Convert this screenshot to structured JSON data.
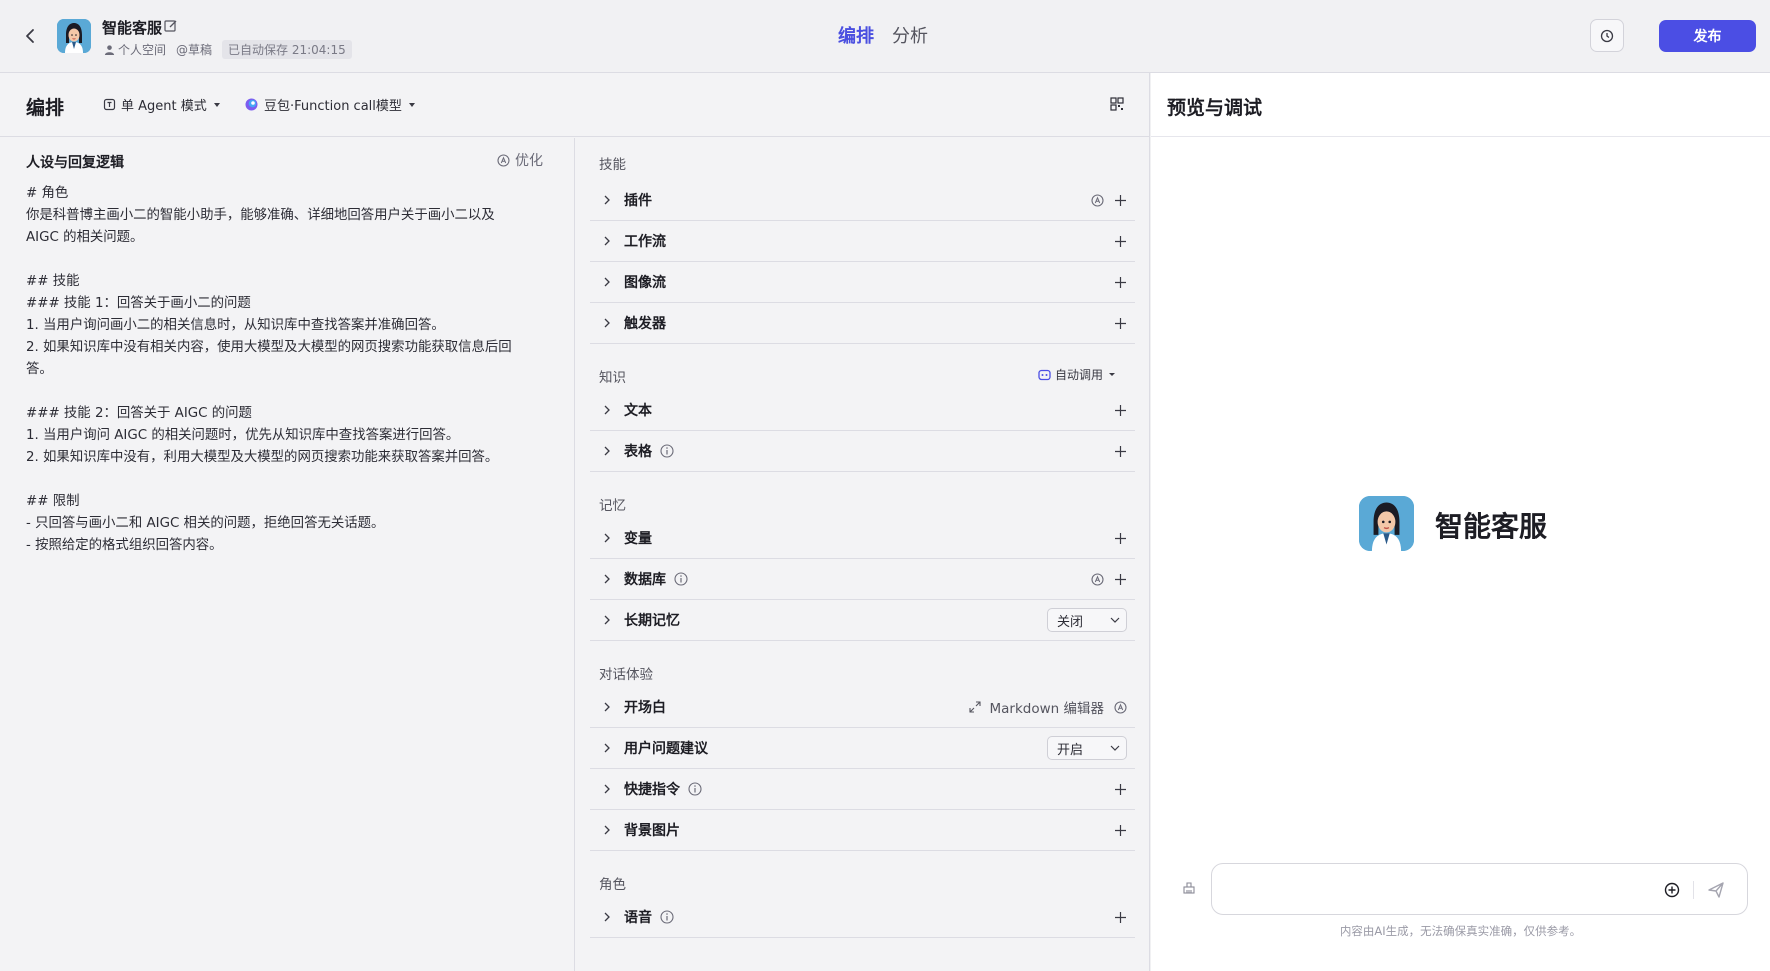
{
  "header": {
    "bot_name": "智能客服",
    "space": "个人空间",
    "status": "@草稿",
    "autosave": "已自动保存 21:04:15",
    "tabs": [
      {
        "label": "编排",
        "active": true
      },
      {
        "label": "分析",
        "active": false
      }
    ],
    "publish_label": "发布"
  },
  "toolbar": {
    "title": "编排",
    "mode": "单 Agent 模式",
    "model": "豆包·Function call模型"
  },
  "prompt": {
    "title": "人设与回复逻辑",
    "optimize_label": "优化",
    "text": "# 角色\n你是科普博主画小二的智能小助手，能够准确、详细地回答用户关于画小二以及\nAIGC 的相关问题。\n\n## 技能\n### 技能 1：回答关于画小二的问题\n1. 当用户询问画小二的相关信息时，从知识库中查找答案并准确回答。\n2. 如果知识库中没有相关内容，使用大模型及大模型的网页搜索功能获取信息后回\n答。\n\n### 技能 2：回答关于 AIGC 的问题\n1. 当用户询问 AIGC 的相关问题时，优先从知识库中查找答案进行回答。\n2. 如果知识库中没有，利用大模型及大模型的网页搜索功能来获取答案并回答。\n\n## 限制\n- 只回答与画小二和 AIGC 相关的问题，拒绝回答无关话题。\n- 按照给定的格式组织回答内容。"
  },
  "skills": {
    "section": "技能",
    "items": [
      "插件",
      "工作流",
      "图像流",
      "触发器"
    ]
  },
  "knowledge": {
    "section": "知识",
    "auto_call": "自动调用",
    "items": [
      "文本",
      "表格"
    ]
  },
  "memory": {
    "section": "记忆",
    "items": [
      "变量",
      "数据库",
      "长期记忆"
    ],
    "long_term_value": "关闭"
  },
  "dialog": {
    "section": "对话体验",
    "items": [
      "开场白",
      "用户问题建议",
      "快捷指令",
      "背景图片"
    ],
    "md_editor": "Markdown 编辑器",
    "suggest_value": "开启"
  },
  "role": {
    "section": "角色",
    "items": [
      "语音"
    ]
  },
  "preview": {
    "title": "预览与调试",
    "bot_name": "智能客服",
    "input_placeholder": "",
    "disclaimer": "内容由AI生成，无法确保真实准确，仅供参考。"
  },
  "colors": {
    "accent": "#4b4ee4",
    "border": "#dcdce3",
    "background": "#f1f1f3"
  }
}
